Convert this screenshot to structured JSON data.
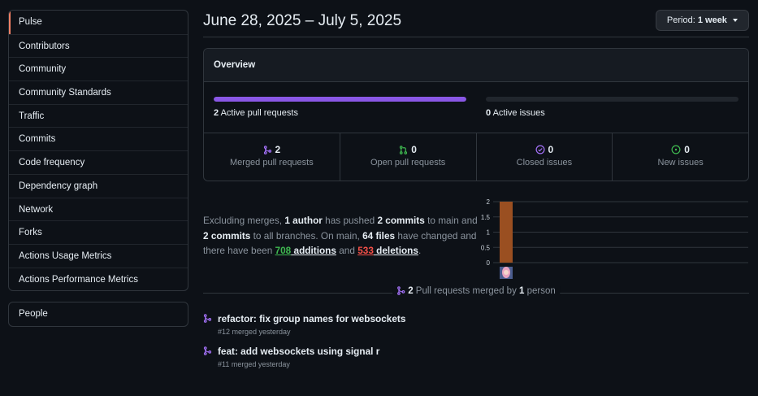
{
  "sidebar": {
    "items": [
      {
        "label": "Pulse"
      },
      {
        "label": "Contributors"
      },
      {
        "label": "Community"
      },
      {
        "label": "Community Standards"
      },
      {
        "label": "Traffic"
      },
      {
        "label": "Commits"
      },
      {
        "label": "Code frequency"
      },
      {
        "label": "Dependency graph"
      },
      {
        "label": "Network"
      },
      {
        "label": "Forks"
      },
      {
        "label": "Actions Usage Metrics"
      },
      {
        "label": "Actions Performance Metrics"
      }
    ],
    "secondary": [
      {
        "label": "People"
      }
    ]
  },
  "header": {
    "date_range": "June 28, 2025 – July 5, 2025",
    "period_prefix": "Period:",
    "period_value": "1 week"
  },
  "overview": {
    "title": "Overview",
    "pull_requests": {
      "count": "2",
      "label": "Active pull requests",
      "fill_fraction": 1.0
    },
    "issues": {
      "count": "0",
      "label": "Active issues",
      "fill_fraction": 0.0
    },
    "stats": [
      {
        "value": "2",
        "label": "Merged pull requests",
        "icon": "git-merge-icon"
      },
      {
        "value": "0",
        "label": "Open pull requests",
        "icon": "git-pull-request-icon"
      },
      {
        "value": "0",
        "label": "Closed issues",
        "icon": "issue-closed-icon"
      },
      {
        "value": "0",
        "label": "New issues",
        "icon": "issue-opened-icon"
      }
    ]
  },
  "summary": {
    "t1": "Excluding merges, ",
    "authors": "1 author",
    "t2": " has pushed ",
    "commits_main": "2 commits",
    "t3": " to main and ",
    "commits_all": "2 commits",
    "t4": " to all branches. On main, ",
    "files": "64 files",
    "t5": " have changed and there have been ",
    "additions_num": "708",
    "additions_word": " additions",
    "t6": " and ",
    "deletions_num": "533",
    "deletions_word": " deletions",
    "t7": "."
  },
  "chart_data": {
    "type": "bar",
    "categories": [
      "author"
    ],
    "values": [
      2
    ],
    "yticks": [
      "2",
      "1.5",
      "1",
      "0.5",
      "0"
    ],
    "ylim": [
      0,
      2
    ],
    "bar_color": "#9a4f21",
    "grid": true
  },
  "merged": {
    "count": "2",
    "mid": " Pull requests merged by ",
    "people": "1",
    "suffix": " person",
    "items": [
      {
        "title": "refactor: fix group names for websockets",
        "meta": "#12 merged yesterday"
      },
      {
        "title": "feat: add websockets using signal r",
        "meta": "#11 merged yesterday"
      }
    ]
  },
  "colors": {
    "accent_purple": "#8957e5",
    "merge_icon": "#a371f7",
    "open_icon": "#3fb950",
    "selected_marker": "#f78166",
    "additions": "#3fb950",
    "deletions": "#f85149"
  }
}
